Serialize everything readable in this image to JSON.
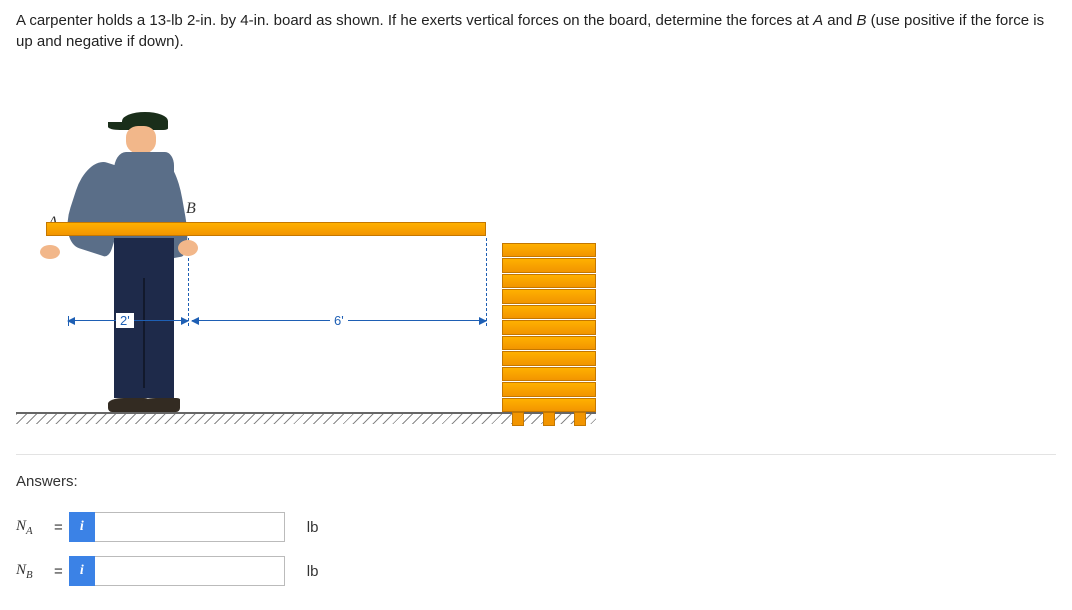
{
  "problem": {
    "text_pre": "A carpenter holds a 13-lb 2-in. by 4-in. board as shown. If he exerts vertical forces on the board, determine the forces at ",
    "point_a": "A",
    "mid": " and ",
    "point_b": "B",
    "text_post": " (use positive if the force is up and negative if down)."
  },
  "figure": {
    "label_a": "A",
    "label_b": "B",
    "dim_ab": "2'",
    "dim_b_end": "6'"
  },
  "answers": {
    "heading": "Answers:",
    "rows": [
      {
        "var_main": "N",
        "var_sub": "A",
        "unit": "lb",
        "value": ""
      },
      {
        "var_main": "N",
        "var_sub": "B",
        "unit": "lb",
        "value": ""
      }
    ],
    "info_icon": "i",
    "equals": "="
  }
}
